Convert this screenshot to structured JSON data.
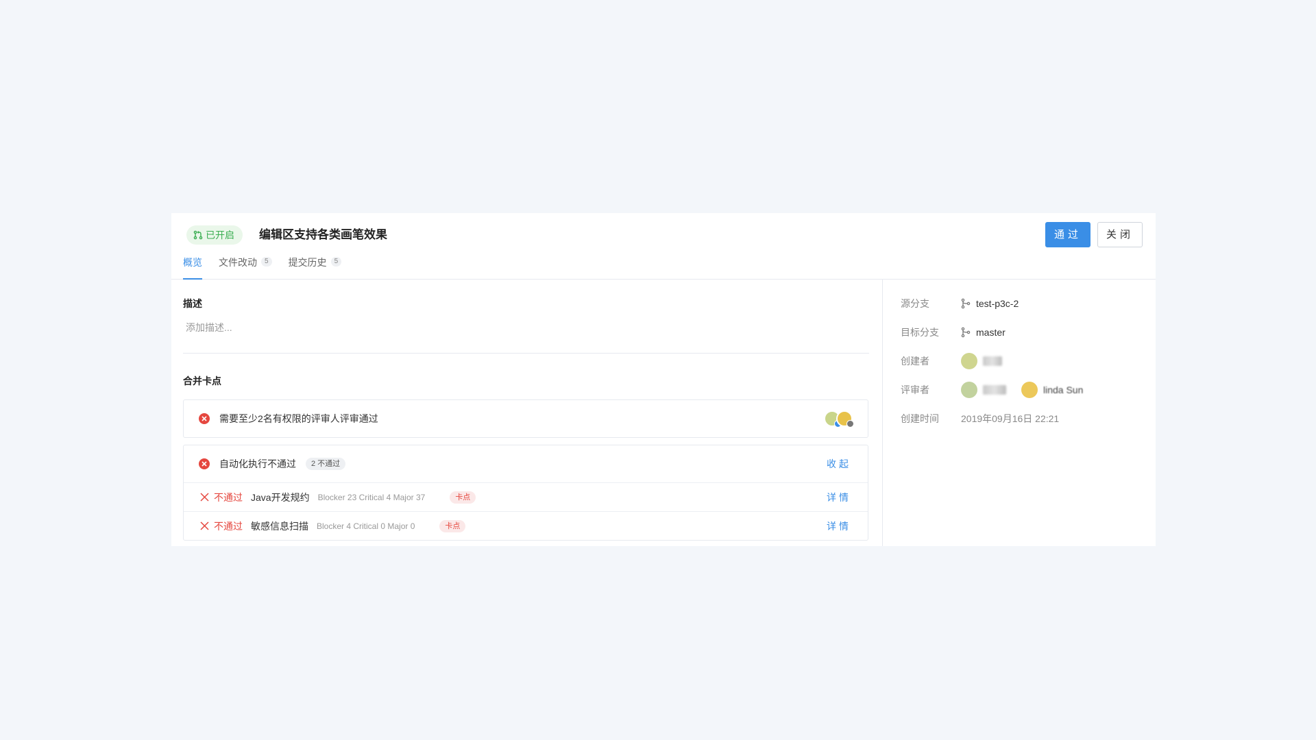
{
  "header": {
    "status_label": "已开启",
    "title": "编辑区支持各类画笔效果",
    "approve_label": "通过",
    "close_label": "关闭"
  },
  "tabs": [
    {
      "label": "概览",
      "count": "",
      "active": true
    },
    {
      "label": "文件改动",
      "count": "5",
      "active": false
    },
    {
      "label": "提交历史",
      "count": "5",
      "active": false
    }
  ],
  "description": {
    "title": "描述",
    "placeholder": "添加描述..."
  },
  "merge_gates": {
    "title": "合并卡点",
    "review": {
      "text": "需要至少2名有权限的评审人评审通过"
    },
    "automation": {
      "text": "自动化执行不通过",
      "badge": "2 不通过",
      "collapse_label": "收起",
      "checks": [
        {
          "status": "不通过",
          "name": "Java开发规约",
          "stats": "Blocker 23 Critical 4 Major 37",
          "tag": "卡点",
          "action": "详情"
        },
        {
          "status": "不通过",
          "name": "敏感信息扫描",
          "stats": "Blocker 4 Critical 0 Major 0",
          "tag": "卡点",
          "action": "详情"
        }
      ]
    }
  },
  "info": {
    "source_branch_label": "源分支",
    "source_branch": "test-p3c-2",
    "target_branch_label": "目标分支",
    "target_branch": "master",
    "creator_label": "创建者",
    "reviewer_label": "评审者",
    "reviewer_2_name": "linda Sun",
    "created_time_label": "创建时间",
    "created_time": "2019年09月16日 22:21"
  },
  "colors": {
    "primary": "#3a8ee6",
    "success": "#3bae52",
    "danger": "#e5473f"
  }
}
